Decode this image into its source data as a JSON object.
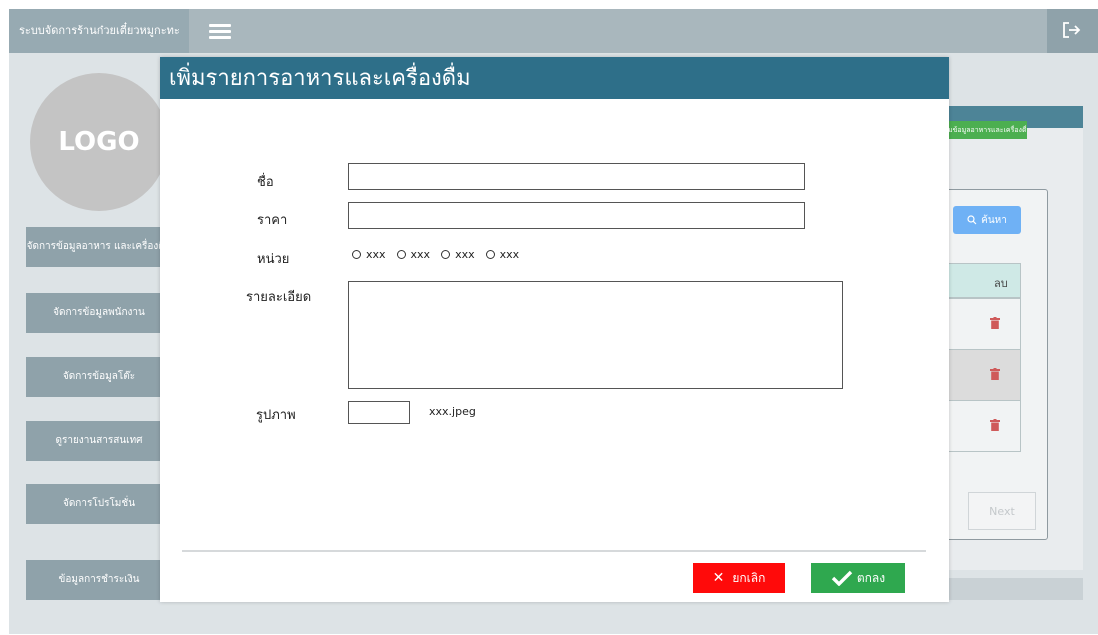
{
  "app": {
    "title": "ระบบจัดการร้านก๋วยเตี๋ยวหมูกะทะ"
  },
  "logo_text": "LOGO",
  "sidebar": {
    "items": [
      {
        "label": "จัดการข้อมูลอาหาร และเครื่องดื่ม"
      },
      {
        "label": "จัดการข้อมูลพนักงาน"
      },
      {
        "label": "จัดการข้อมูลโต๊ะ"
      },
      {
        "label": "ดูรายงานสารสนเทศ"
      },
      {
        "label": "จัดการโปรโมชั่น"
      },
      {
        "label": "ข้อมูลการชำระเงิน"
      }
    ]
  },
  "background": {
    "add_button_label": "เพิ่มข้อมูลอาหารและเครื่องดื่ม",
    "search_label": "ค้นหา",
    "table_delete_header": "ลบ",
    "next_label": "Next"
  },
  "modal": {
    "title": "เพิ่มรายการอาหารและเครื่องดื่ม",
    "name_label": "ชื่อ",
    "name_value": "",
    "price_label": "ราคา",
    "price_value": "",
    "unit_label": "หน่วย",
    "unit_options": [
      "xxx",
      "xxx",
      "xxx",
      "xxx"
    ],
    "detail_label": "รายละเอียด",
    "detail_value": "",
    "image_label": "รูปภาพ",
    "image_filename": "xxx.jpeg",
    "cancel_label": "ยกเลิก",
    "ok_label": "ตกลง"
  },
  "colors": {
    "topbar": "#a9b7bd",
    "modal_header": "#2e6f89",
    "cancel": "#ff0a0a",
    "ok": "#2fa84f",
    "sidebar_button": "#8fa2aa"
  }
}
